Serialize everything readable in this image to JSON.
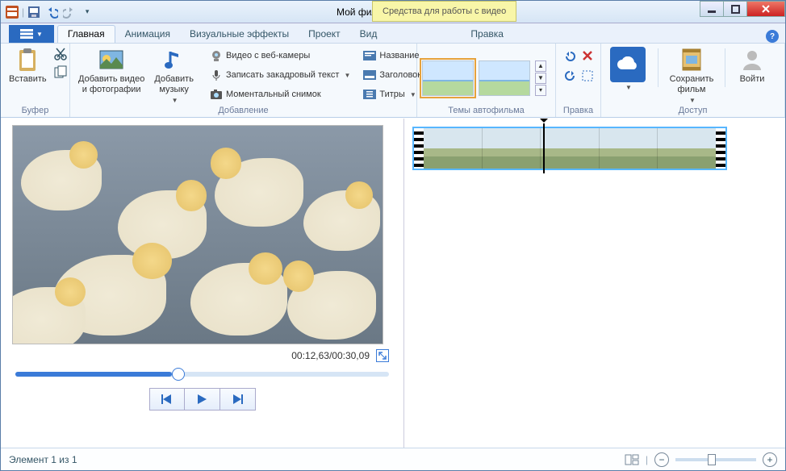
{
  "title": "Мой фильм - Киностудия",
  "context_tab": "Средства для работы с видео",
  "tabs": {
    "main": "Главная",
    "animation": "Анимация",
    "visual": "Визуальные эффекты",
    "project": "Проект",
    "view": "Вид",
    "edit": "Правка"
  },
  "groups": {
    "buffer": "Буфер",
    "adding": "Добавление",
    "themes": "Темы автофильма",
    "editgrp": "Правка",
    "access": "Доступ"
  },
  "buttons": {
    "paste": "Вставить",
    "add_video": "Добавить видео\nи фотографии",
    "add_music": "Добавить\nмузыку",
    "webcam": "Видео с веб-камеры",
    "voiceover": "Записать закадровый текст",
    "snapshot": "Моментальный снимок",
    "title": "Название",
    "caption": "Заголовок",
    "credits": "Титры",
    "save_movie": "Сохранить\nфильм",
    "signin": "Войти"
  },
  "preview": {
    "time": "00:12,63/00:30,09"
  },
  "status": {
    "element": "Элемент 1 из 1"
  }
}
